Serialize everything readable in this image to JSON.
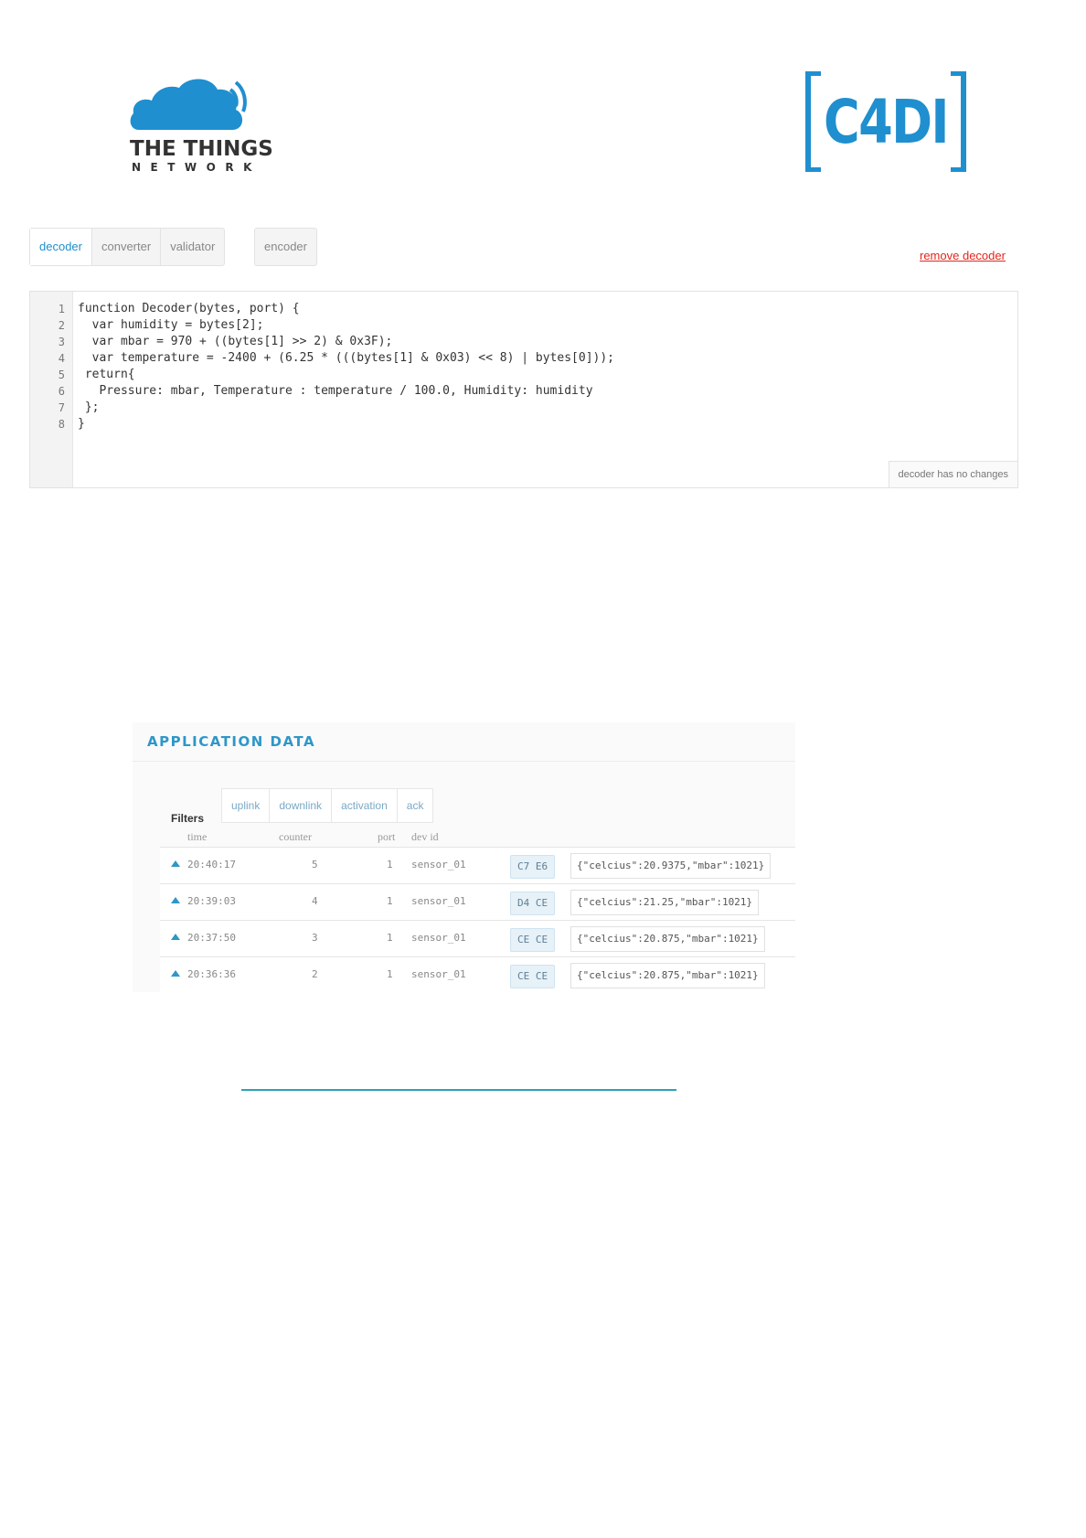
{
  "logos": {
    "ttn_title": "THE THINGS",
    "ttn_subtitle": "NETWORK",
    "c4di": "C4DI",
    "ttn_color": "#1f8fcf",
    "c4di_color": "#1f8fcf"
  },
  "tabs": {
    "group1": [
      "decoder",
      "converter",
      "validator"
    ],
    "group2": [
      "encoder"
    ],
    "active": "decoder"
  },
  "remove_link": "remove decoder",
  "editor": {
    "line_numbers": [
      "1",
      "2",
      "3",
      "4",
      "5",
      "6",
      "7",
      "8"
    ],
    "lines": [
      "function Decoder(bytes, port) {",
      "  var humidity = bytes[2];",
      "  var mbar = 970 + ((bytes[1] >> 2) & 0x3F);",
      "  var temperature = -2400 + (6.25 * (((bytes[1] & 0x03) << 8) | bytes[0]));",
      " return{",
      "   Pressure: mbar, Temperature : temperature / 100.0, Humidity: humidity",
      " };",
      "}"
    ],
    "status": "decoder has no changes"
  },
  "application_data": {
    "title": "APPLICATION DATA",
    "filters_label": "Filters",
    "filters": [
      "uplink",
      "downlink",
      "activation",
      "ack"
    ],
    "columns": [
      "time",
      "counter",
      "port",
      "dev id"
    ],
    "rows": [
      {
        "time": "20:40:17",
        "counter": "5",
        "port": "1",
        "dev_id": "sensor_01",
        "payload": "C7 E6",
        "fields": "{\"celcius\":20.9375,\"mbar\":1021}"
      },
      {
        "time": "20:39:03",
        "counter": "4",
        "port": "1",
        "dev_id": "sensor_01",
        "payload": "D4 CE",
        "fields": "{\"celcius\":21.25,\"mbar\":1021}"
      },
      {
        "time": "20:37:50",
        "counter": "3",
        "port": "1",
        "dev_id": "sensor_01",
        "payload": "CE CE",
        "fields": "{\"celcius\":20.875,\"mbar\":1021}"
      },
      {
        "time": "20:36:36",
        "counter": "2",
        "port": "1",
        "dev_id": "sensor_01",
        "payload": "CE CE",
        "fields": "{\"celcius\":20.875,\"mbar\":1021}"
      }
    ]
  }
}
